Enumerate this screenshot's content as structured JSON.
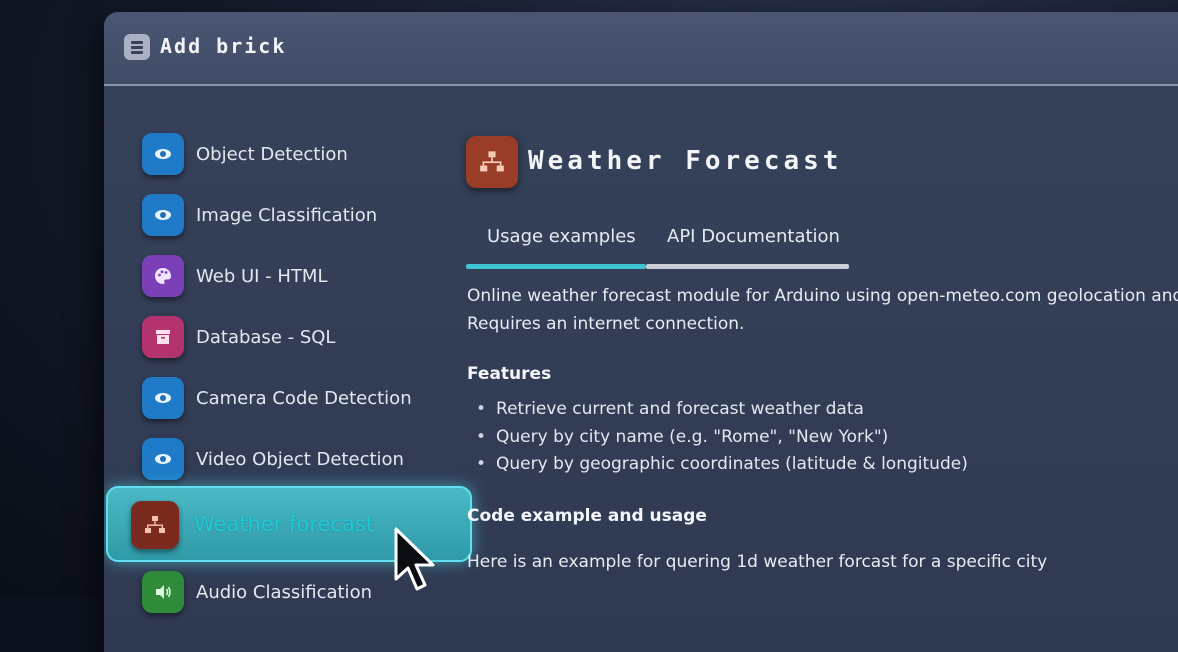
{
  "window": {
    "title": "Add brick"
  },
  "sidebar": {
    "items": [
      {
        "label": "Object Detection",
        "icon": "eye-icon",
        "color": "#1f7bc7"
      },
      {
        "label": "Image Classification",
        "icon": "eye-icon",
        "color": "#1f7bc7"
      },
      {
        "label": "Web UI - HTML",
        "icon": "palette-icon",
        "color": "#7b3fb8"
      },
      {
        "label": "Database - SQL",
        "icon": "archive-icon",
        "color": "#b2336d"
      },
      {
        "label": "Camera Code Detection",
        "icon": "eye-icon",
        "color": "#1f7bc7"
      },
      {
        "label": "Video Object Detection",
        "icon": "eye-icon",
        "color": "#1f7bc7"
      },
      {
        "label": "Weather forecast",
        "icon": "network-icon",
        "color": "#7a2a1e",
        "selected": true
      },
      {
        "label": "Audio Classification",
        "icon": "sound-icon",
        "color": "#2f8a3a"
      }
    ]
  },
  "detail": {
    "title": "Weather Forecast",
    "icon": "network-icon",
    "tabs": [
      {
        "label": "Usage examples",
        "active": true
      },
      {
        "label": "API Documentation",
        "active": false
      }
    ],
    "description_line1": "Online weather forecast module for Arduino using open-meteo.com geolocation and w",
    "description_line2": "Requires an internet connection.",
    "features_heading": "Features",
    "features": [
      "Retrieve current and forecast weather data",
      "Query by city name (e.g. \"Rome\", \"New York\")",
      "Query by geographic coordinates (latitude & longitude)"
    ],
    "code_heading": "Code example and usage",
    "code_intro": "Here is an example for quering 1d weather forcast for a specific city"
  },
  "colors": {
    "accent": "#3fc4d2",
    "selected_text": "#1ec9d8"
  }
}
